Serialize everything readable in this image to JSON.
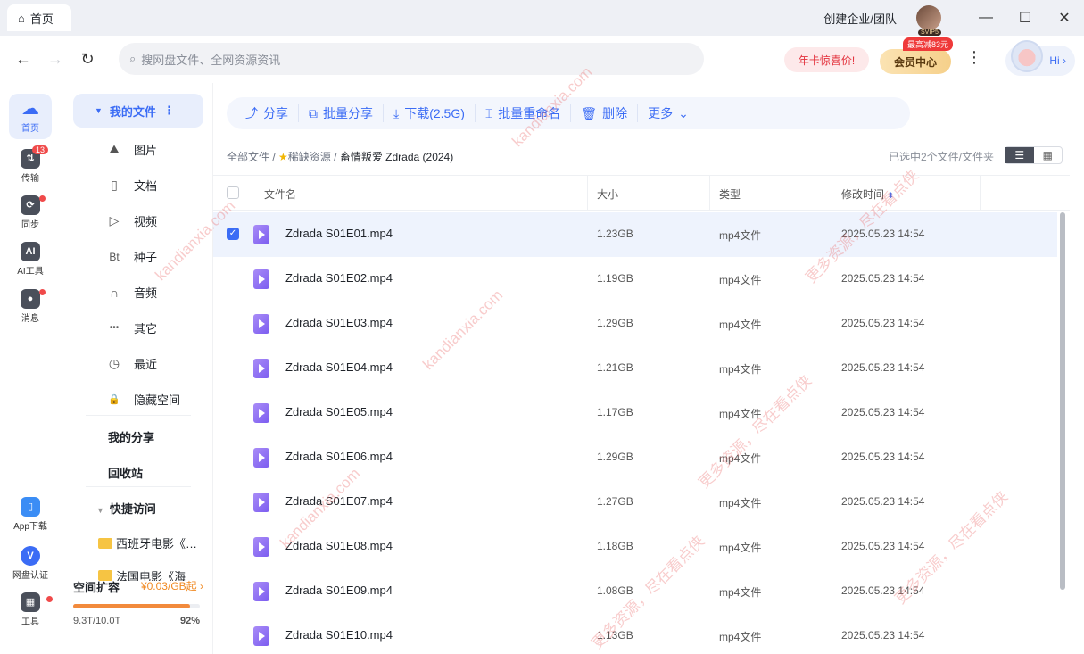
{
  "titlebar": {
    "home_tab": "首页",
    "team_link": "创建企业/团队",
    "avatar_badge": "SVIP5"
  },
  "nav": {
    "search_placeholder": "搜网盘文件、全网资源资讯",
    "promo": "年卡惊喜价!",
    "vip_center": "会员中心",
    "vip_badge": "最高减83元",
    "hi": "Hi"
  },
  "rail": [
    {
      "label": "首页",
      "icon": "cloud-icon"
    },
    {
      "label": "传输",
      "icon": "transfer-icon",
      "badge": "13"
    },
    {
      "label": "同步",
      "icon": "sync-icon"
    },
    {
      "label": "AI工具",
      "icon": "ai-icon",
      "glyph": "AI"
    },
    {
      "label": "消息",
      "icon": "message-icon"
    },
    {
      "label": "App下载",
      "icon": "phone-icon"
    },
    {
      "label": "网盘认证",
      "icon": "verify-icon",
      "glyph": "V"
    },
    {
      "label": "工具",
      "icon": "tools-icon"
    }
  ],
  "sidebar": {
    "my_files": "我的文件",
    "items": [
      {
        "label": "图片",
        "icon": "image-icon",
        "glyph": "⛰"
      },
      {
        "label": "文档",
        "icon": "document-icon",
        "glyph": "▯"
      },
      {
        "label": "视频",
        "icon": "video-icon",
        "glyph": "▷"
      },
      {
        "label": "种子",
        "icon": "torrent-icon",
        "glyph": "Bt"
      },
      {
        "label": "音频",
        "icon": "headphone-icon",
        "glyph": "∩"
      },
      {
        "label": "其它",
        "icon": "more-icon",
        "glyph": "•••"
      },
      {
        "label": "最近",
        "icon": "clock-icon",
        "glyph": "◷"
      },
      {
        "label": "隐藏空间",
        "icon": "lock-icon",
        "glyph": "🔒"
      }
    ],
    "my_share": "我的分享",
    "recycle": "回收站",
    "quick_access": "快捷访问",
    "folders": [
      "西班牙电影《…",
      "法国电影《海"
    ],
    "space": {
      "title": "空间扩容",
      "price": "¥0.03/GB起",
      "used": "9.3T/10.0T",
      "percent": "92%",
      "fill": 0.92
    }
  },
  "toolbar": [
    "分享",
    "批量分享",
    "下载(2.5G)",
    "批量重命名",
    "删除",
    "更多"
  ],
  "breadcrumb": {
    "root": "全部文件",
    "mid": "稀缺资源",
    "current": "畜情叛爱 Zdrada (2024)"
  },
  "selection_info": "已选中2个文件/文件夹",
  "columns": {
    "name": "文件名",
    "size": "大小",
    "type": "类型",
    "modified": "修改时间"
  },
  "files": [
    {
      "name": "Zdrada S01E01.mp4",
      "size": "1.23GB",
      "type": "mp4文件",
      "date": "2025.05.23 14:54",
      "checked": true
    },
    {
      "name": "Zdrada S01E02.mp4",
      "size": "1.19GB",
      "type": "mp4文件",
      "date": "2025.05.23 14:54"
    },
    {
      "name": "Zdrada S01E03.mp4",
      "size": "1.29GB",
      "type": "mp4文件",
      "date": "2025.05.23 14:54"
    },
    {
      "name": "Zdrada S01E04.mp4",
      "size": "1.21GB",
      "type": "mp4文件",
      "date": "2025.05.23 14:54"
    },
    {
      "name": "Zdrada S01E05.mp4",
      "size": "1.17GB",
      "type": "mp4文件",
      "date": "2025.05.23 14:54"
    },
    {
      "name": "Zdrada S01E06.mp4",
      "size": "1.29GB",
      "type": "mp4文件",
      "date": "2025.05.23 14:54"
    },
    {
      "name": "Zdrada S01E07.mp4",
      "size": "1.27GB",
      "type": "mp4文件",
      "date": "2025.05.23 14:54"
    },
    {
      "name": "Zdrada S01E08.mp4",
      "size": "1.18GB",
      "type": "mp4文件",
      "date": "2025.05.23 14:54"
    },
    {
      "name": "Zdrada S01E09.mp4",
      "size": "1.08GB",
      "type": "mp4文件",
      "date": "2025.05.23 14:54"
    },
    {
      "name": "Zdrada S01E10.mp4",
      "size": "1.13GB",
      "type": "mp4文件",
      "date": "2025.05.23 14:54"
    }
  ],
  "watermark": {
    "site": "kandianxia.com",
    "slogan": "更多资源，尽在看点侠"
  }
}
